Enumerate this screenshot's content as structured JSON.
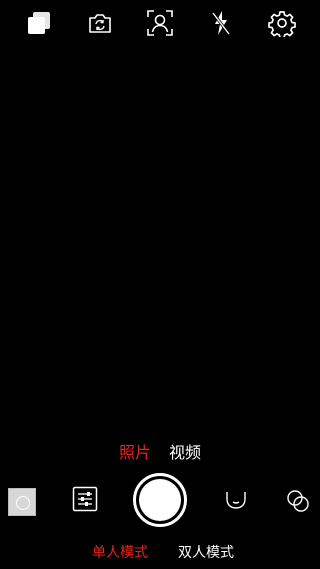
{
  "top_bar": {
    "icons": [
      "gallery-icon",
      "camera-switch-icon",
      "portrait-focus-icon",
      "flash-off-icon",
      "settings-icon"
    ]
  },
  "capture_modes": {
    "photo": "照片",
    "video": "视频",
    "active": "photo"
  },
  "person_modes": {
    "single": "单人模式",
    "double": "双人模式",
    "active": "single"
  },
  "colors": {
    "background": "#000000",
    "active_tab": "#e0261d",
    "inactive_tab": "#ffffff"
  }
}
